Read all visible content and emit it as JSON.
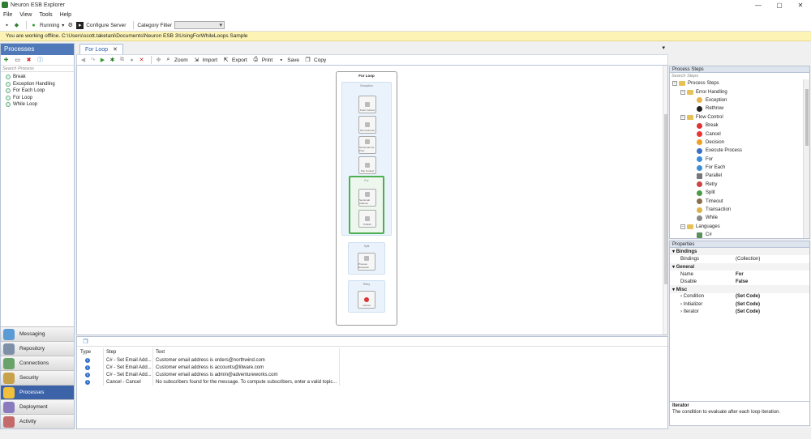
{
  "window": {
    "title": "Neuron ESB Explorer"
  },
  "menu": [
    "File",
    "View",
    "Tools",
    "Help"
  ],
  "toolbar": {
    "status": "Running",
    "configure_server": "Configure Server",
    "category_filter": "Category Filter"
  },
  "offline_notice": "You are working offline. C:\\Users\\scott.taketani\\Documents\\Neuron ESB 3\\UsingForWhileLoops Sample",
  "left": {
    "title": "Processes",
    "search_placeholder": "Search Process",
    "processes": [
      "Break",
      "Exception Handling",
      "For Each Loop",
      "For Loop",
      "While Loop"
    ],
    "nav": [
      "Messaging",
      "Repository",
      "Connections",
      "Security",
      "Processes",
      "Deployment",
      "Activity"
    ],
    "nav_selected": "Processes"
  },
  "designer": {
    "tab": "For Loop",
    "tools": [
      "Zoom",
      "Import",
      "Export",
      "Print",
      "Save",
      "Copy"
    ],
    "flow_title": "For Loop",
    "blocks": {
      "exception": "Exception",
      "steps1": [
        "Push Context",
        "Set Customer",
        "Set Email List Prop",
        "Pop Context"
      ],
      "for": "For",
      "steps2": [
        "Set Email Address",
        "Publish"
      ],
      "split": "Split",
      "split_step": "Process Exception",
      "retry": "Retry",
      "retry_step": "Cancel"
    }
  },
  "output": {
    "columns": [
      "Type",
      "Step",
      "Text"
    ],
    "rows": [
      {
        "step": "C# - Set Email Add...",
        "text": "Customer email address is orders@northwind.com"
      },
      {
        "step": "C# - Set Email Add...",
        "text": "Customer email address is accounts@litware.com"
      },
      {
        "step": "C# - Set Email Add...",
        "text": "Customer email address is admin@adventureworks.com"
      },
      {
        "step": "Cancel - Cancel",
        "text": "No subscribers found for the message. To compute subscribers, enter a valid topic..."
      }
    ]
  },
  "process_steps": {
    "title": "Process Steps",
    "search_placeholder": "Search Steps",
    "root": "Process Steps",
    "error_handling": "Error Handling",
    "error_items": [
      "Exception",
      "Rethrow"
    ],
    "flow_control": "Flow Control",
    "flow_items": [
      "Break",
      "Cancel",
      "Decision",
      "Execute Process",
      "For",
      "For Each",
      "Parallel",
      "Retry",
      "Split",
      "Timeout",
      "Transaction",
      "While"
    ],
    "languages": "Languages",
    "lang_items": [
      "C#"
    ]
  },
  "properties": {
    "title": "Properties",
    "groups": [
      {
        "name": "Bindings",
        "rows": [
          [
            "Bindings",
            "(Collection)"
          ]
        ]
      },
      {
        "name": "General",
        "rows": [
          [
            "Name",
            "For"
          ],
          [
            "Disable",
            "False"
          ]
        ]
      },
      {
        "name": "Misc",
        "rows": [
          [
            "Condition",
            "(Set Code)"
          ],
          [
            "Initializer",
            "(Set Code)"
          ],
          [
            "Iterator",
            "(Set Code)"
          ]
        ]
      }
    ],
    "desc_title": "Iterator",
    "desc_text": "The condition to evaluate after each loop iteration."
  }
}
